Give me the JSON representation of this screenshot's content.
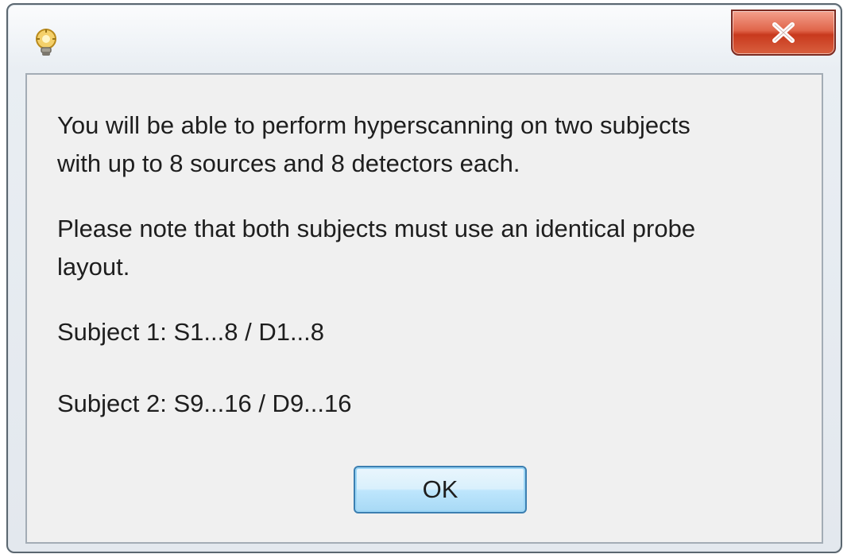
{
  "window": {
    "title_icon": "lightbulb-gear-icon",
    "close_icon": "close-x-icon"
  },
  "dialog": {
    "message_1": "You will be able to perform hyperscanning on two subjects\nwith up to 8 sources and 8 detectors each.",
    "message_2": "Please note that both subjects must use an identical probe\nlayout.",
    "subject_1": "Subject 1: S1...8 / D1...8",
    "subject_2": "Subject 2: S9...16 / D9...16",
    "ok_label": "OK"
  },
  "colors": {
    "close_button": "#d9603f",
    "ok_button_border": "#3c7fb1",
    "panel_background": "#f0f0f0"
  }
}
